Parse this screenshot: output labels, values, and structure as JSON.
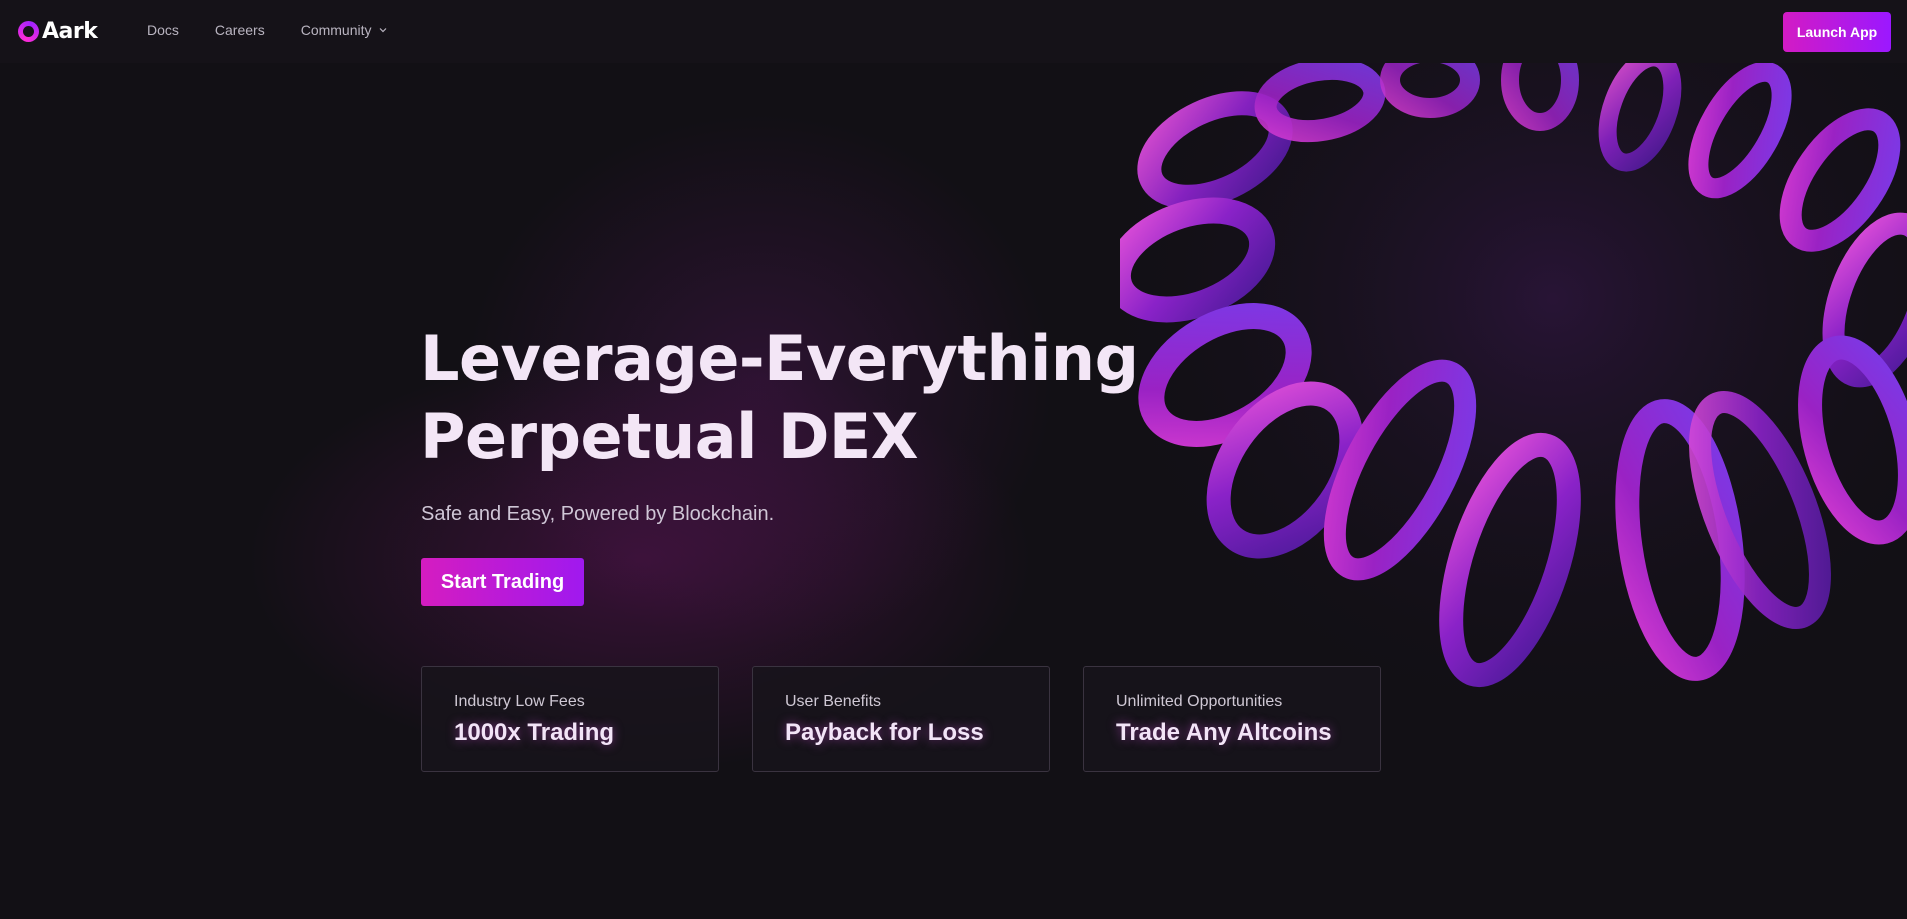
{
  "brand": {
    "name": "Aark",
    "accent": "#c41ae0",
    "accent_gradient": [
      "#d31bc4",
      "#9b18ff"
    ]
  },
  "nav": {
    "items": [
      {
        "label": "Docs"
      },
      {
        "label": "Careers"
      },
      {
        "label": "Community",
        "icon": "chevron-down-icon"
      }
    ],
    "launch_label": "Launch App"
  },
  "hero": {
    "headline_line1": "Leverage-Everything",
    "headline_line2": "Perpetual DEX",
    "subtitle": "Safe and Easy, Powered by Blockchain.",
    "cta_label": "Start Trading"
  },
  "features": [
    {
      "label": "Industry Low Fees",
      "value": "1000x Trading"
    },
    {
      "label": "User Benefits",
      "value": "Payback for Loss"
    },
    {
      "label": "Unlimited Opportunities",
      "value": "Trade Any Altcoins"
    }
  ]
}
